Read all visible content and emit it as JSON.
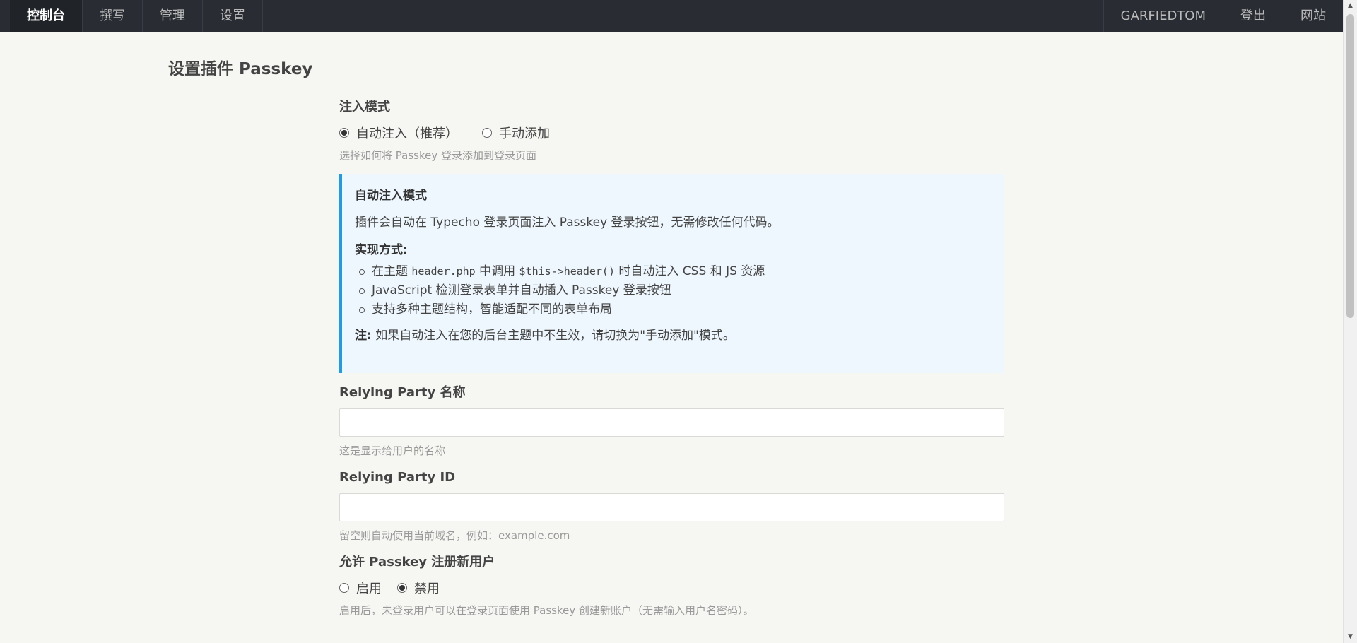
{
  "nav": {
    "left": [
      "控制台",
      "撰写",
      "管理",
      "设置"
    ],
    "right": [
      "GARFIEDTOM",
      "登出",
      "网站"
    ]
  },
  "page_title": "设置插件 Passkey",
  "inject_mode": {
    "label": "注入模式",
    "options": [
      "自动注入（推荐）",
      "手动添加"
    ],
    "selected": "自动注入（推荐）",
    "description": "选择如何将 Passkey 登录添加到登录页面"
  },
  "note": {
    "title": "自动注入模式",
    "text": "插件会自动在 Typecho 登录页面注入 Passkey 登录按钮，无需修改任何代码。",
    "how_title": "实现方式:",
    "item1_a": "在主题 ",
    "item1_code1": "header.php",
    "item1_b": " 中调用 ",
    "item1_code2": "$this->header()",
    "item1_c": " 时自动注入 CSS 和 JS 资源",
    "item2": "JavaScript 检测登录表单并自动插入 Passkey 登录按钮",
    "item3": "支持多种主题结构，智能适配不同的表单布局",
    "foot_label": "注:",
    "foot_text": " 如果自动注入在您的后台主题中不生效，请切换为\"手动添加\"模式。"
  },
  "rp_name": {
    "label": "Relying Party 名称",
    "value": "",
    "description": "这是显示给用户的名称"
  },
  "rp_id": {
    "label": "Relying Party ID",
    "value": "",
    "description": "留空则自动使用当前域名，例如：example.com"
  },
  "allow_register": {
    "label": "允许 Passkey 注册新用户",
    "options": [
      "启用",
      "禁用"
    ],
    "selected": "禁用",
    "description": "启用后，未登录用户可以在登录页面使用 Passkey 创建新账户（无需输入用户名密码）。"
  }
}
